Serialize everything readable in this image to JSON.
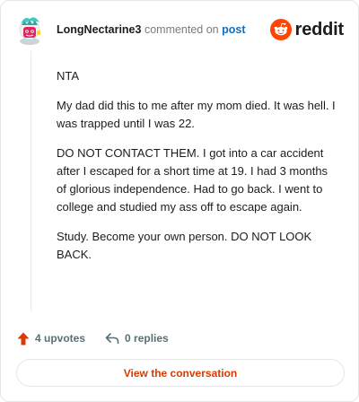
{
  "header": {
    "username": "LongNectarine3",
    "commented_text": "commented on",
    "post_link": "post",
    "brand_word": "reddit"
  },
  "comment": {
    "paragraphs": [
      "NTA",
      "My dad did this to me after my mom died. It was hell. I was trapped until I was 22.",
      "DO NOT CONTACT THEM. I got into a car accident after I escaped for a short time at 19. I had 3 months of glorious independence. Had to go back. I went to college and studied my ass off to escape again.",
      "Study. Become your own person. DO NOT LOOK BACK."
    ]
  },
  "actions": {
    "upvotes": "4 upvotes",
    "replies": "0 replies"
  },
  "cta": {
    "label": "View the conversation"
  },
  "colors": {
    "brand_orange": "#ff4500",
    "cta_text": "#d93a00",
    "link_blue": "#0f6fbf",
    "avatar_teal": "#45c9c3"
  },
  "icons": {
    "avatar": "snoo-avatar-icon",
    "brand": "reddit-logo-icon",
    "upvote": "upvote-arrow-icon",
    "reply": "reply-arrow-icon"
  }
}
